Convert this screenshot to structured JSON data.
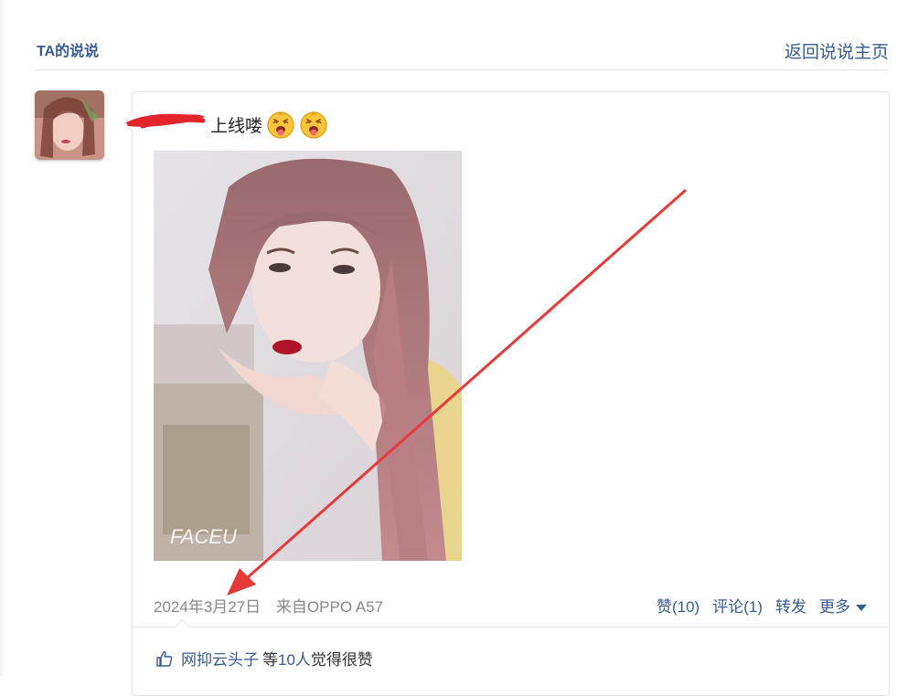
{
  "header": {
    "title": "TA的说说",
    "back_link": "返回说说主页"
  },
  "post": {
    "text": "上线喽",
    "emoji_count": 2,
    "emoji_icon": "tongue-face-icon",
    "date": "2024年3月27日",
    "source": "来自OPPO A57",
    "photo_watermark": "FACEU"
  },
  "actions": {
    "like": "赞(10)",
    "comment": "评论(1)",
    "share": "转发",
    "more": "更多"
  },
  "likes": {
    "name": "网抑云头子",
    "mid": "等",
    "count": "10人",
    "suffix": "觉得很赞"
  },
  "colors": {
    "link": "#3a5b8f",
    "annotation_arrow": "#e63a3a",
    "redaction": "#e2252b"
  }
}
